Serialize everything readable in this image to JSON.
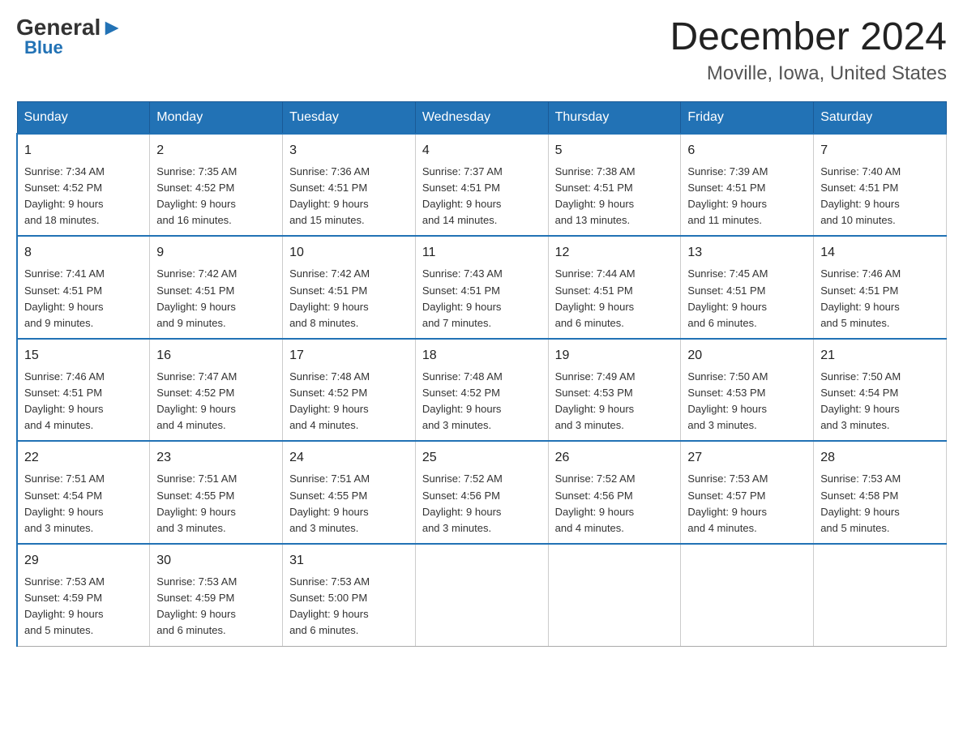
{
  "logo": {
    "general": "General",
    "blue": "Blue",
    "arrow": "▶"
  },
  "title": "December 2024",
  "subtitle": "Moville, Iowa, United States",
  "weekdays": [
    "Sunday",
    "Monday",
    "Tuesday",
    "Wednesday",
    "Thursday",
    "Friday",
    "Saturday"
  ],
  "weeks": [
    [
      {
        "day": "1",
        "sunrise": "7:34 AM",
        "sunset": "4:52 PM",
        "daylight": "9 hours and 18 minutes."
      },
      {
        "day": "2",
        "sunrise": "7:35 AM",
        "sunset": "4:52 PM",
        "daylight": "9 hours and 16 minutes."
      },
      {
        "day": "3",
        "sunrise": "7:36 AM",
        "sunset": "4:51 PM",
        "daylight": "9 hours and 15 minutes."
      },
      {
        "day": "4",
        "sunrise": "7:37 AM",
        "sunset": "4:51 PM",
        "daylight": "9 hours and 14 minutes."
      },
      {
        "day": "5",
        "sunrise": "7:38 AM",
        "sunset": "4:51 PM",
        "daylight": "9 hours and 13 minutes."
      },
      {
        "day": "6",
        "sunrise": "7:39 AM",
        "sunset": "4:51 PM",
        "daylight": "9 hours and 11 minutes."
      },
      {
        "day": "7",
        "sunrise": "7:40 AM",
        "sunset": "4:51 PM",
        "daylight": "9 hours and 10 minutes."
      }
    ],
    [
      {
        "day": "8",
        "sunrise": "7:41 AM",
        "sunset": "4:51 PM",
        "daylight": "9 hours and 9 minutes."
      },
      {
        "day": "9",
        "sunrise": "7:42 AM",
        "sunset": "4:51 PM",
        "daylight": "9 hours and 9 minutes."
      },
      {
        "day": "10",
        "sunrise": "7:42 AM",
        "sunset": "4:51 PM",
        "daylight": "9 hours and 8 minutes."
      },
      {
        "day": "11",
        "sunrise": "7:43 AM",
        "sunset": "4:51 PM",
        "daylight": "9 hours and 7 minutes."
      },
      {
        "day": "12",
        "sunrise": "7:44 AM",
        "sunset": "4:51 PM",
        "daylight": "9 hours and 6 minutes."
      },
      {
        "day": "13",
        "sunrise": "7:45 AM",
        "sunset": "4:51 PM",
        "daylight": "9 hours and 6 minutes."
      },
      {
        "day": "14",
        "sunrise": "7:46 AM",
        "sunset": "4:51 PM",
        "daylight": "9 hours and 5 minutes."
      }
    ],
    [
      {
        "day": "15",
        "sunrise": "7:46 AM",
        "sunset": "4:51 PM",
        "daylight": "9 hours and 4 minutes."
      },
      {
        "day": "16",
        "sunrise": "7:47 AM",
        "sunset": "4:52 PM",
        "daylight": "9 hours and 4 minutes."
      },
      {
        "day": "17",
        "sunrise": "7:48 AM",
        "sunset": "4:52 PM",
        "daylight": "9 hours and 4 minutes."
      },
      {
        "day": "18",
        "sunrise": "7:48 AM",
        "sunset": "4:52 PM",
        "daylight": "9 hours and 3 minutes."
      },
      {
        "day": "19",
        "sunrise": "7:49 AM",
        "sunset": "4:53 PM",
        "daylight": "9 hours and 3 minutes."
      },
      {
        "day": "20",
        "sunrise": "7:50 AM",
        "sunset": "4:53 PM",
        "daylight": "9 hours and 3 minutes."
      },
      {
        "day": "21",
        "sunrise": "7:50 AM",
        "sunset": "4:54 PM",
        "daylight": "9 hours and 3 minutes."
      }
    ],
    [
      {
        "day": "22",
        "sunrise": "7:51 AM",
        "sunset": "4:54 PM",
        "daylight": "9 hours and 3 minutes."
      },
      {
        "day": "23",
        "sunrise": "7:51 AM",
        "sunset": "4:55 PM",
        "daylight": "9 hours and 3 minutes."
      },
      {
        "day": "24",
        "sunrise": "7:51 AM",
        "sunset": "4:55 PM",
        "daylight": "9 hours and 3 minutes."
      },
      {
        "day": "25",
        "sunrise": "7:52 AM",
        "sunset": "4:56 PM",
        "daylight": "9 hours and 3 minutes."
      },
      {
        "day": "26",
        "sunrise": "7:52 AM",
        "sunset": "4:56 PM",
        "daylight": "9 hours and 4 minutes."
      },
      {
        "day": "27",
        "sunrise": "7:53 AM",
        "sunset": "4:57 PM",
        "daylight": "9 hours and 4 minutes."
      },
      {
        "day": "28",
        "sunrise": "7:53 AM",
        "sunset": "4:58 PM",
        "daylight": "9 hours and 5 minutes."
      }
    ],
    [
      {
        "day": "29",
        "sunrise": "7:53 AM",
        "sunset": "4:59 PM",
        "daylight": "9 hours and 5 minutes."
      },
      {
        "day": "30",
        "sunrise": "7:53 AM",
        "sunset": "4:59 PM",
        "daylight": "9 hours and 6 minutes."
      },
      {
        "day": "31",
        "sunrise": "7:53 AM",
        "sunset": "5:00 PM",
        "daylight": "9 hours and 6 minutes."
      },
      null,
      null,
      null,
      null
    ]
  ],
  "labels": {
    "sunrise": "Sunrise:",
    "sunset": "Sunset:",
    "daylight": "Daylight:"
  }
}
